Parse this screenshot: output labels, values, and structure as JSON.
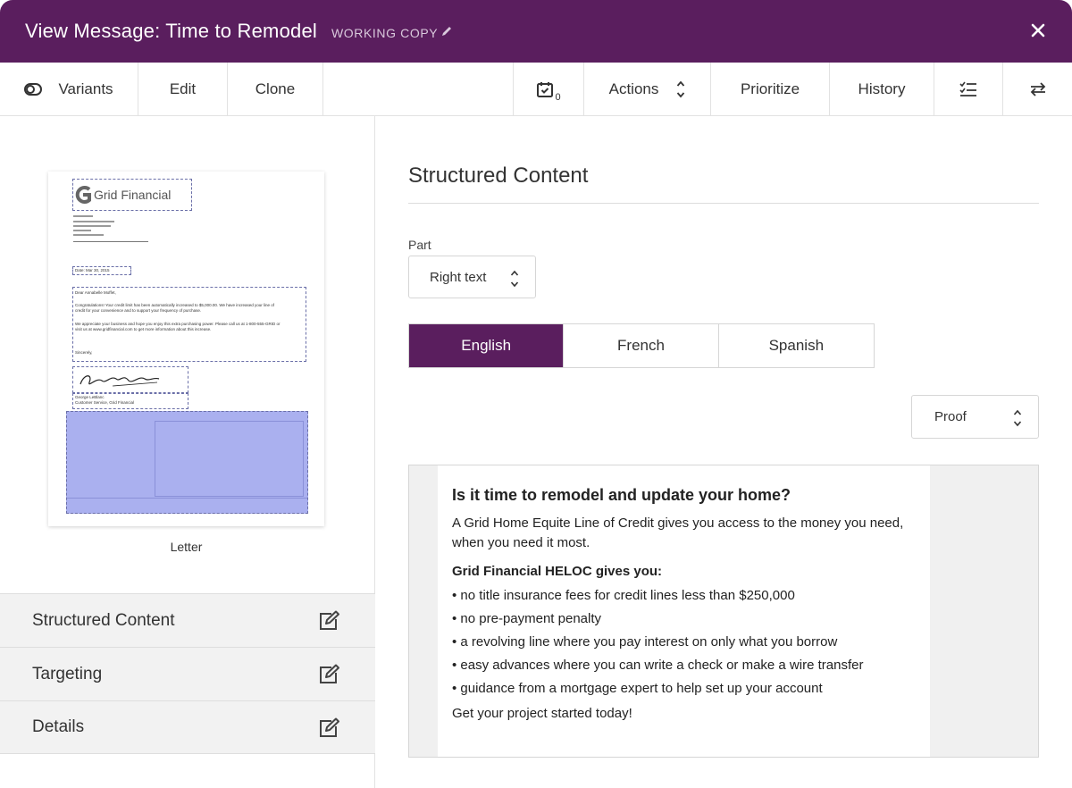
{
  "window": {
    "title": "View Message: Time to Remodel",
    "status": "WORKING COPY"
  },
  "toolbar": {
    "variants": "Variants",
    "edit": "Edit",
    "clone": "Clone",
    "calendar_count": "0",
    "actions": "Actions",
    "prioritize": "Prioritize",
    "history": "History"
  },
  "thumbnail": {
    "logo": "Grid Financial",
    "date": "Date: Mar 30, 2015",
    "greeting": "Dear Annabelle Moffet,",
    "body1": "Congratulations! Your credit limit has been automatically increased to $5,000.00. We have increased your line of credit for your convenience and to support your frequency of purchase.",
    "body2": "We appreciate your business and hope you enjoy this extra purchasing power. Please call us at 1-800-555-GRID or visit us at www.gridfinancial.com to get more information about this increase.",
    "closing": "Sincerely,",
    "signer": "George LeBlanc",
    "signer_title": "Customer Service, Grid Financial",
    "label": "Letter"
  },
  "accordion": [
    {
      "label": "Structured Content"
    },
    {
      "label": "Targeting"
    },
    {
      "label": "Details"
    }
  ],
  "content": {
    "title": "Structured Content",
    "part_label": "Part",
    "part_value": "Right text",
    "languages": [
      "English",
      "French",
      "Spanish"
    ],
    "active_language": "English",
    "proof_value": "Proof"
  },
  "preview": {
    "heading": "Is it time to remodel and update your home?",
    "intro": "A Grid Home Equite Line of Credit gives you access to the money you need, when you need it most.",
    "subheading": "Grid Financial HELOC gives you:",
    "bullets": [
      "• no title insurance fees for credit lines less than $250,000",
      "• no pre-payment penalty",
      "• a revolving line where you pay interest on only what you borrow",
      "• easy advances where you can write a check or make a wire transfer",
      "• guidance from a mortgage expert to help set up your account"
    ],
    "cta": "Get your project started today!"
  },
  "colors": {
    "brand_purple": "#5a1e5e",
    "highlight_blue": "#aab0ef"
  },
  "icons": {
    "toggle": "toggle-icon",
    "calendar": "calendar-check-icon",
    "sort": "chevron-updown-icon",
    "checklist": "checklist-icon",
    "swap": "swap-arrows-icon",
    "edit": "edit-square-icon",
    "close": "close-icon",
    "pencil": "pencil-icon"
  }
}
